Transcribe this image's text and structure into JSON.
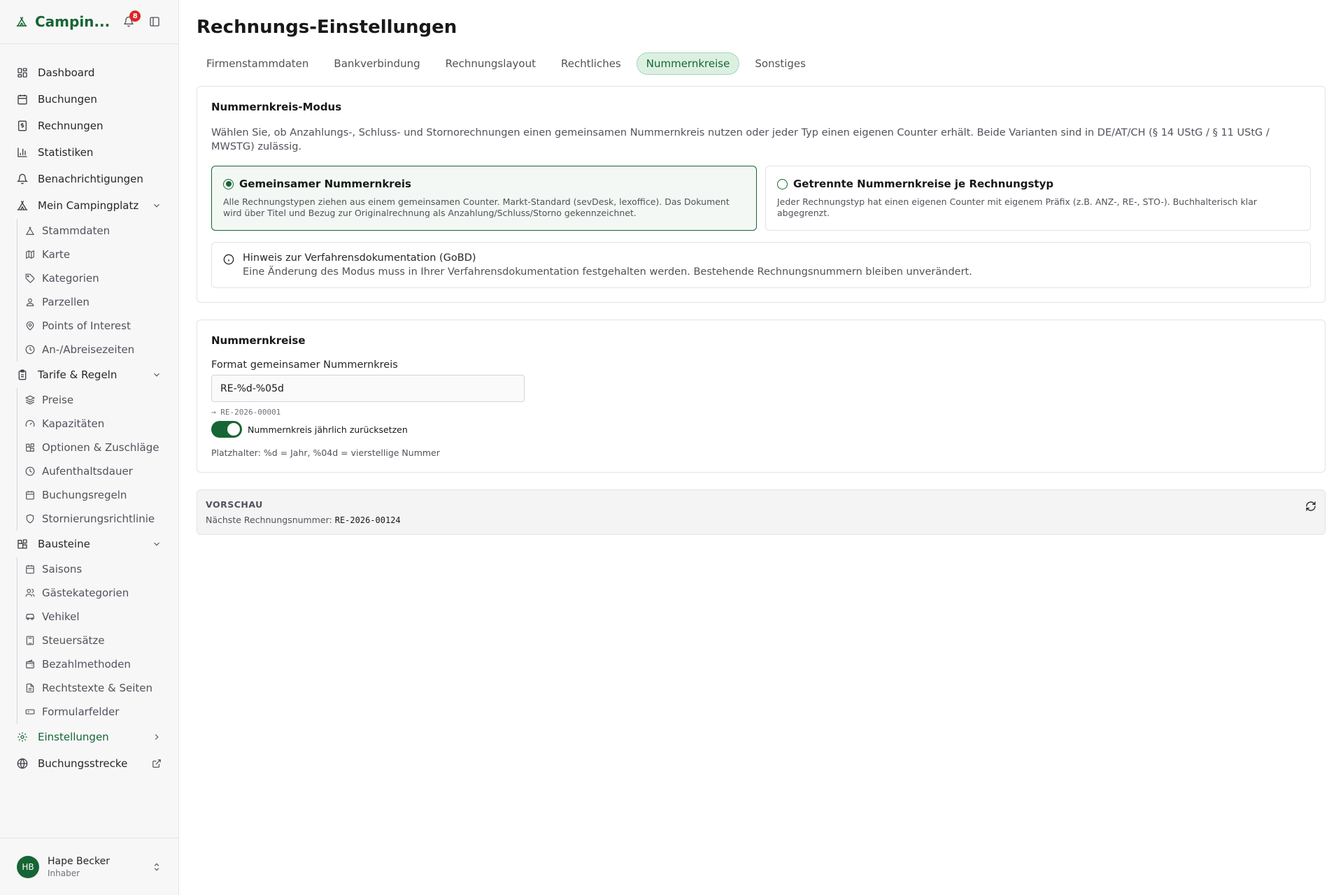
{
  "app": {
    "brand": "Campin...",
    "notifications_count": "8"
  },
  "sidebar": {
    "items": [
      {
        "label": "Dashboard",
        "icon": "dashboard-icon"
      },
      {
        "label": "Buchungen",
        "icon": "calendar-icon"
      },
      {
        "label": "Rechnungen",
        "icon": "receipt-icon"
      },
      {
        "label": "Statistiken",
        "icon": "bar-chart-icon"
      },
      {
        "label": "Benachrichtigungen",
        "icon": "bell-icon"
      }
    ],
    "campingplatz": {
      "label": "Mein Campingplatz",
      "children": [
        "Stammdaten",
        "Karte",
        "Kategorien",
        "Parzellen",
        "Points of Interest",
        "An-/Abreisezeiten"
      ]
    },
    "tarife": {
      "label": "Tarife & Regeln",
      "children": [
        "Preise",
        "Kapazitäten",
        "Optionen & Zuschläge",
        "Aufenthaltsdauer",
        "Buchungsregeln",
        "Stornierungsrichtlinie"
      ]
    },
    "bausteine": {
      "label": "Bausteine",
      "children": [
        "Saisons",
        "Gästekategorien",
        "Vehikel",
        "Steuersätze",
        "Bezahlmethoden",
        "Rechtstexte & Seiten",
        "Formularfelder"
      ]
    },
    "settings_label": "Einstellungen",
    "booking_label": "Buchungsstrecke",
    "user": {
      "initials": "HB",
      "name": "Hape Becker",
      "role": "Inhaber"
    }
  },
  "main": {
    "title": "Rechnungs-Einstellungen",
    "tabs": [
      "Firmenstammdaten",
      "Bankverbindung",
      "Rechnungslayout",
      "Rechtliches",
      "Nummernkreise",
      "Sonstiges"
    ],
    "active_tab": "Nummernkreise",
    "mode": {
      "title": "Nummernkreis-Modus",
      "description": "Wählen Sie, ob Anzahlungs-, Schluss- und Stornorechnungen einen gemeinsamen Nummernkreis nutzen oder jeder Typ einen eigenen Counter erhält. Beide Varianten sind in DE/AT/CH (§ 14 UStG / § 11 UStG / MWSTG) zulässig.",
      "option_shared": {
        "title": "Gemeinsamer Nummernkreis",
        "description": "Alle Rechnungstypen ziehen aus einem gemeinsamen Counter. Markt-Standard (sevDesk, lexoffice). Das Dokument wird über Titel und Bezug zur Originalrechnung als Anzahlung/Schluss/Storno gekennzeichnet.",
        "selected": true
      },
      "option_separate": {
        "title": "Getrennte Nummernkreise je Rechnungstyp",
        "description": "Jeder Rechnungstyp hat einen eigenen Counter mit eigenem Präfix (z.B. ANZ-, RE-, STO-). Buchhalterisch klar abgegrenzt.",
        "selected": false
      },
      "hint_title": "Hinweis zur Verfahrensdokumentation (GoBD)",
      "hint_body": "Eine Änderung des Modus muss in Ihrer Verfahrensdokumentation festgehalten werden. Bestehende Rechnungsnummern bleiben unverändert."
    },
    "numbers": {
      "title": "Nummernkreise",
      "field_label": "Format gemeinsamer Nummernkreis",
      "field_value": "RE-%d-%05d",
      "format_preview": "→ RE-2026-00001",
      "reset_label": "Nummernkreis jährlich zurücksetzen",
      "reset_enabled": true,
      "placeholder_help": "Platzhalter: %d = Jahr, %04d = vierstellige Nummer"
    },
    "preview": {
      "title": "VORSCHAU",
      "label": "Nächste Rechnungsnummer:",
      "value": "RE-2026-00124"
    }
  },
  "colors": {
    "accent": "#166534",
    "badge": "#dc2626"
  }
}
